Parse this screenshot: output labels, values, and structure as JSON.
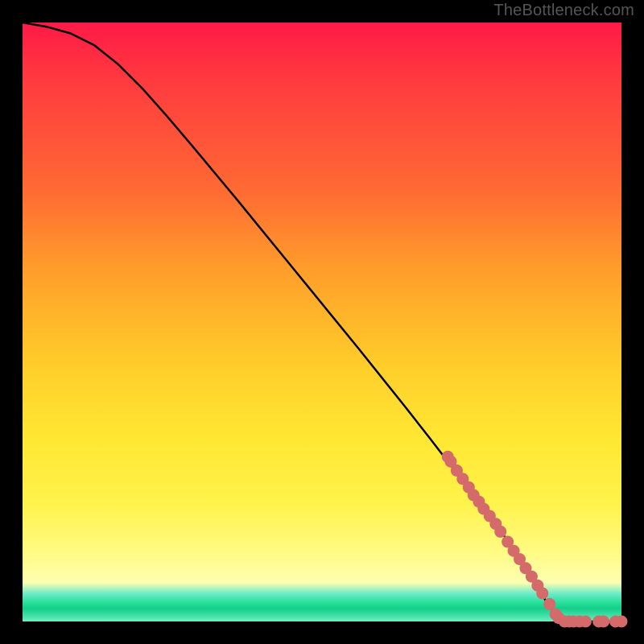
{
  "watermark": "TheBottleneck.com",
  "chart_data": {
    "type": "line",
    "title": "",
    "xlabel": "",
    "ylabel": "",
    "xlim": [
      0,
      100
    ],
    "ylim": [
      0,
      100
    ],
    "grid": false,
    "legend": false,
    "annotations": [
      {
        "text": "TheBottleneck.com",
        "pos": "top-right"
      }
    ],
    "series": [
      {
        "name": "curve",
        "kind": "line",
        "color": "#000000",
        "x": [
          0,
          4,
          8,
          12,
          16,
          20,
          24,
          28,
          32,
          36,
          40,
          44,
          48,
          52,
          56,
          60,
          64,
          68,
          72,
          76,
          80,
          82,
          84,
          86,
          88,
          90,
          92,
          94,
          96,
          98,
          100
        ],
        "y": [
          100,
          99.3,
          98.2,
          96.2,
          93.0,
          89.0,
          84.5,
          79.8,
          75.0,
          70.2,
          65.3,
          60.4,
          55.5,
          50.6,
          45.7,
          40.7,
          35.7,
          30.6,
          25.4,
          20.2,
          14.9,
          12.0,
          8.9,
          5.7,
          2.4,
          0.6,
          0.0,
          0.0,
          0.0,
          0.0,
          0.0
        ]
      },
      {
        "name": "clustered-dots",
        "kind": "scatter",
        "color": "#d46a6a",
        "x": [
          71,
          71.5,
          72.5,
          73.5,
          74.5,
          75.3,
          76.2,
          77,
          78,
          79,
          79.8,
          81,
          82,
          83,
          84,
          85,
          86,
          86.8,
          88,
          89,
          89.5,
          90.5,
          91.3,
          92,
          93,
          94,
          96.2,
          97,
          99,
          100
        ],
        "y": [
          27.5,
          26.7,
          25.2,
          23.8,
          22.4,
          21.1,
          20.0,
          18.8,
          17.6,
          16.3,
          15.0,
          13.3,
          11.8,
          10.4,
          8.9,
          7.5,
          6.0,
          4.7,
          2.9,
          1.2,
          0.6,
          0.0,
          0.0,
          0.0,
          0.0,
          0.0,
          0.0,
          0.0,
          0.0,
          0.0
        ]
      }
    ]
  }
}
